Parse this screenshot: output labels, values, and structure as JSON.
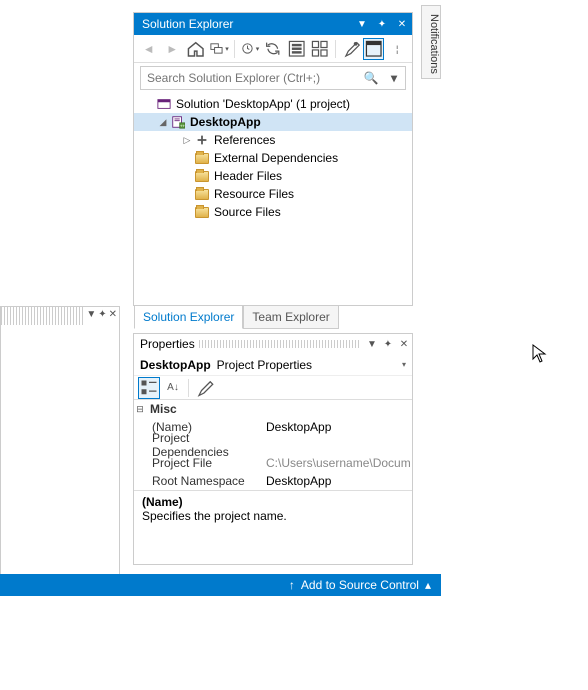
{
  "solutionExplorer": {
    "title": "Solution Explorer",
    "searchPlaceholder": "Search Solution Explorer (Ctrl+;)",
    "root": "Solution 'DesktopApp' (1 project)",
    "project": "DesktopApp",
    "nodes": {
      "references": "References",
      "externalDeps": "External Dependencies",
      "headerFiles": "Header Files",
      "resourceFiles": "Resource Files",
      "sourceFiles": "Source Files"
    },
    "tabs": {
      "active": "Solution Explorer",
      "other": "Team Explorer"
    }
  },
  "properties": {
    "title": "Properties",
    "subjectName": "DesktopApp",
    "subjectType": "Project Properties",
    "category": "Misc",
    "rows": {
      "nameKey": "(Name)",
      "nameVal": "DesktopApp",
      "depsKey": "Project Dependencies",
      "depsVal": "",
      "fileKey": "Project File",
      "fileVal": "C:\\Users\\username\\Docum",
      "nsKey": "Root Namespace",
      "nsVal": "DesktopApp"
    },
    "descTitle": "(Name)",
    "descBody": "Specifies the project name."
  },
  "notifications": "Notifications",
  "statusbar": {
    "sourceControl": "Add to Source Control"
  }
}
